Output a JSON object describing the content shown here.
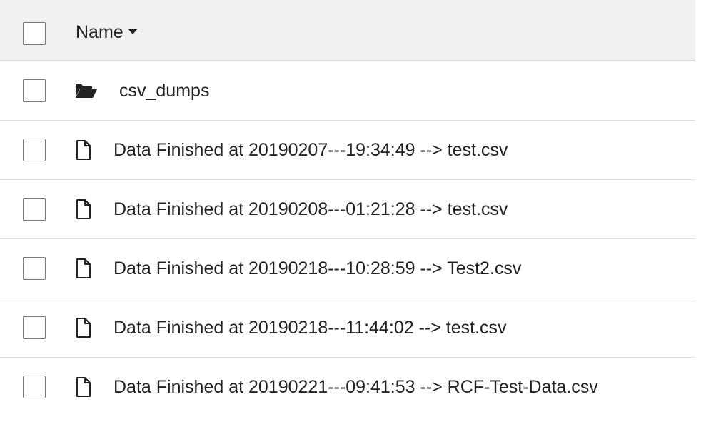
{
  "header": {
    "name_label": "Name"
  },
  "items": [
    {
      "type": "folder",
      "icon": "folder-open-icon",
      "name": "csv_dumps"
    },
    {
      "type": "file",
      "icon": "file-icon",
      "name": "Data Finished at 20190207---19:34:49 --> test.csv"
    },
    {
      "type": "file",
      "icon": "file-icon",
      "name": "Data Finished at 20190208---01:21:28 --> test.csv"
    },
    {
      "type": "file",
      "icon": "file-icon",
      "name": "Data Finished at 20190218---10:28:59 --> Test2.csv"
    },
    {
      "type": "file",
      "icon": "file-icon",
      "name": "Data Finished at 20190218---11:44:02 --> test.csv"
    },
    {
      "type": "file",
      "icon": "file-icon",
      "name": "Data Finished at 20190221---09:41:53 --> RCF-Test-Data.csv"
    }
  ]
}
